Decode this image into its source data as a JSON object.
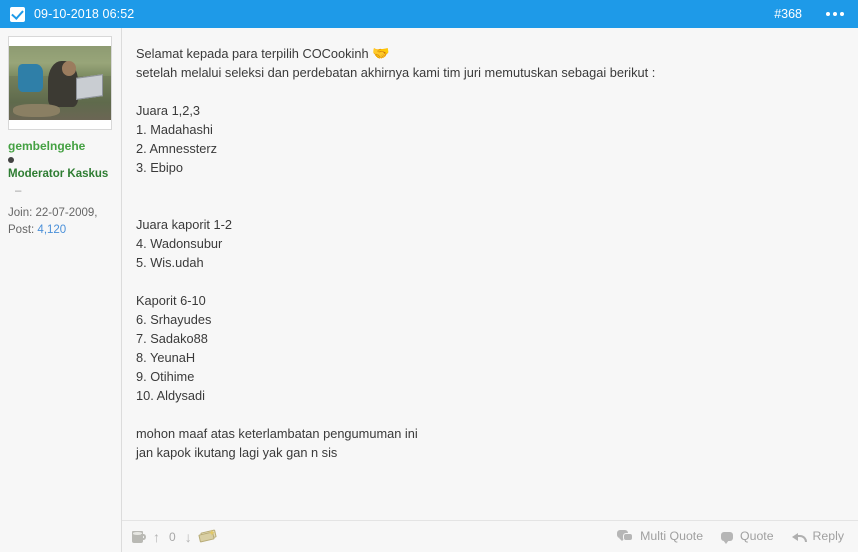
{
  "header": {
    "checkbox_icon": "checkbox-checked-icon",
    "date": "09-10-2018 06:52",
    "post_number": "#368",
    "more_icon": "more-options-icon",
    "background_color": "#1e9ae8"
  },
  "sidebar": {
    "avatar_alt": "user-avatar-photo",
    "username": "gembelngehe",
    "status_dot": "online-status-dot",
    "user_title": "Moderator Kaskus",
    "divider_dash": "–",
    "join_label": "Join: 22-07-2009,",
    "post_label": "Post:",
    "post_count": "4,120",
    "username_color": "#45a143",
    "title_color": "#2e7d32",
    "link_color": "#4a90d9"
  },
  "message": {
    "lines": [
      "Selamat kepada para terpilih COCookinh ",
      "setelah melalui seleksi dan perdebatan akhirnya kami tim juri memutuskan sebagai berikut :",
      "",
      "Juara 1,2,3",
      "1. Madahashi",
      "2. Amnessterz",
      "3. Ebipo",
      "",
      "",
      "Juara kaporit 1-2",
      "4. Wadonsubur",
      "5. Wis.udah",
      "",
      "Kaporit 6-10",
      "6. Srhayudes",
      "7. Sadako88",
      "8. YeunaH",
      "9. Otihime",
      "10. Aldysadi",
      "",
      "mohon maaf atas keterlambatan pengumuman ini",
      "jan kapok ikutang lagi yak gan n sis"
    ],
    "emoji": "🤝",
    "emoji_name": "handshake-emoji"
  },
  "footer": {
    "mug_icon": "mug-icon",
    "upvote_icon": "arrow-up-icon",
    "vote_count": "0",
    "downvote_icon": "arrow-down-icon",
    "cash_icon": "cash-reputation-icon",
    "multi_quote_label": "Multi Quote",
    "quote_label": "Quote",
    "reply_label": "Reply",
    "multi_quote_icon": "multi-speech-bubble-icon",
    "quote_icon": "speech-bubble-icon",
    "reply_icon": "reply-arrow-icon"
  }
}
